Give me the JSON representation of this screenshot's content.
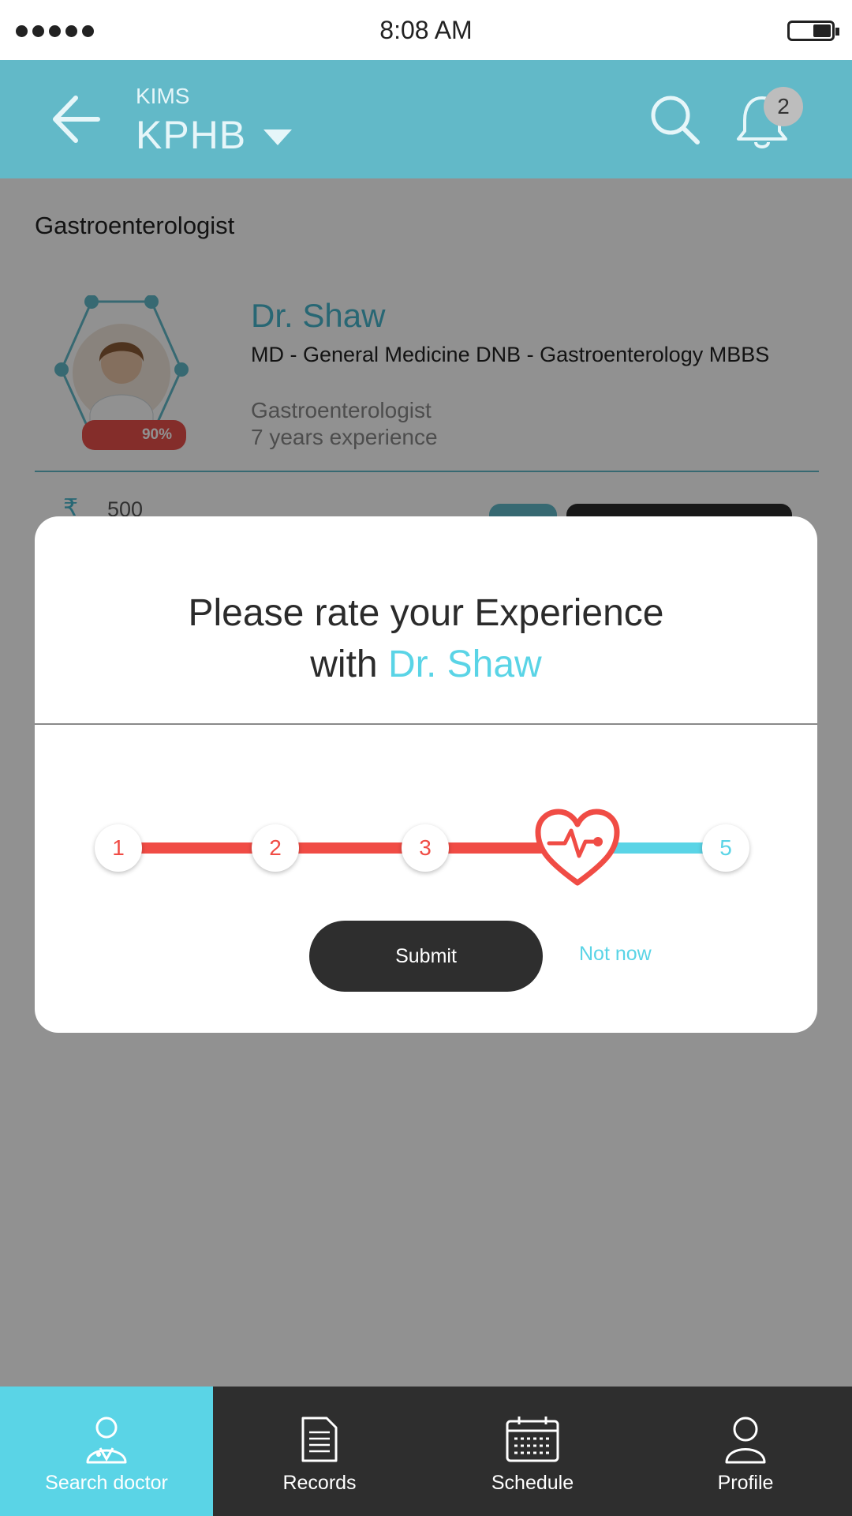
{
  "status_bar": {
    "time": "8:08 AM"
  },
  "header": {
    "hospital_name": "KIMS",
    "branch": "KPHB",
    "notification_count": "2",
    "accent": "#62b9c8"
  },
  "content": {
    "section_title": "Gastroenterologist",
    "doctor": {
      "name": "Dr. Shaw",
      "degree": "MD - General Medicine DNB - Gastroenterology MBBS",
      "specialty": "Gastroenterologist",
      "experience": "7 years experience",
      "score": "90%",
      "rupee_symbol": "₹",
      "fee": "500"
    }
  },
  "modal": {
    "title_line1": "Please rate your Experience",
    "title_with": "with",
    "doctor_name": "Dr. Shaw",
    "rating_steps": [
      "1",
      "2",
      "3",
      "4",
      "5"
    ],
    "selected_rating": 4,
    "submit_label": "Submit",
    "not_now_label": "Not now",
    "colors": {
      "selected": "#f04c45",
      "unselected": "#5ad4e6"
    }
  },
  "tabbar": {
    "tabs": [
      {
        "label": "Search doctor",
        "icon": "doctor-icon",
        "active": true
      },
      {
        "label": "Records",
        "icon": "document-icon",
        "active": false
      },
      {
        "label": "Schedule",
        "icon": "calendar-icon",
        "active": false
      },
      {
        "label": "Profile",
        "icon": "person-icon",
        "active": false
      }
    ],
    "active_color": "#5ad4e6"
  }
}
